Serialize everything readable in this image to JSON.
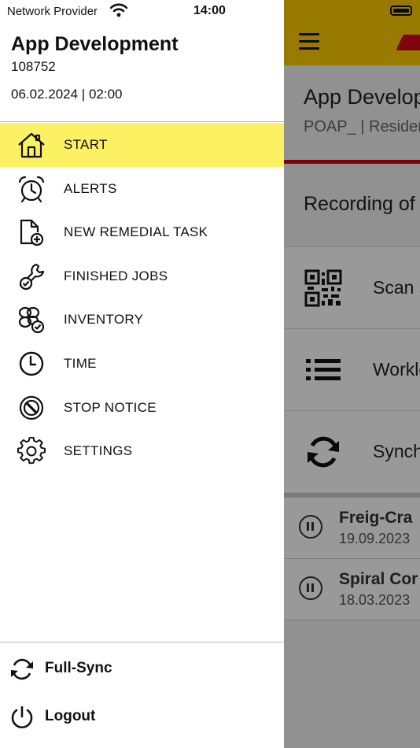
{
  "status_bar": {
    "carrier": "Network Provider",
    "time": "14:00"
  },
  "drawer": {
    "title": "App Development",
    "code": "108752",
    "datetime": "06.02.2024 | 02:00",
    "nav": [
      {
        "label": "START",
        "icon": "house-icon",
        "active": true
      },
      {
        "label": "ALERTS",
        "icon": "alarm-clock-icon",
        "active": false
      },
      {
        "label": "NEW REMEDIAL TASK",
        "icon": "document-add-icon",
        "active": false
      },
      {
        "label": "FINISHED JOBS",
        "icon": "wrench-check-icon",
        "active": false
      },
      {
        "label": "INVENTORY",
        "icon": "boxes-check-icon",
        "active": false
      },
      {
        "label": "TIME",
        "icon": "clock-icon",
        "active": false
      },
      {
        "label": "STOP NOTICE",
        "icon": "stop-sign-icon",
        "active": false
      },
      {
        "label": "SETTINGS",
        "icon": "gear-icon",
        "active": false
      }
    ],
    "footer": [
      {
        "label": "Full-Sync",
        "icon": "sync-icon"
      },
      {
        "label": "Logout",
        "icon": "power-icon"
      }
    ]
  },
  "background_app": {
    "title": "App Develop",
    "subtitle": "POAP_ | Resider",
    "recording_label": "Recording of",
    "menu": [
      {
        "label": "Scan s",
        "icon": "qr-code-icon"
      },
      {
        "label": "Workle",
        "icon": "list-icon"
      },
      {
        "label": "Synch",
        "icon": "sync-icon"
      }
    ],
    "jobs": [
      {
        "title": "Freig-Cra",
        "date": "19.09.2023"
      },
      {
        "title": "Spiral Cor",
        "date": "18.03.2023"
      }
    ]
  },
  "colors": {
    "accent_yellow": "#ffcc00",
    "active_highlight": "#fcf063",
    "brand_red": "#d40511"
  }
}
